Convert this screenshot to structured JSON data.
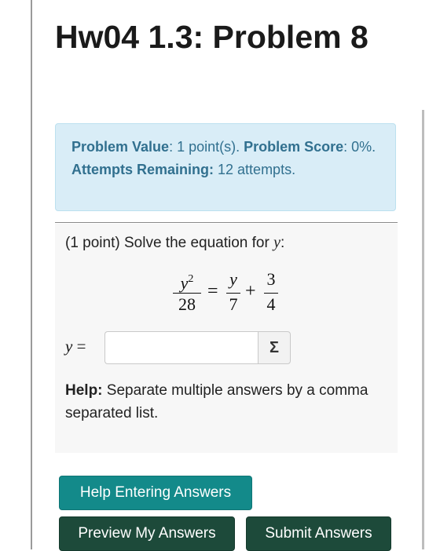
{
  "page": {
    "title": "Hw04 1.3: Problem 8"
  },
  "info": {
    "value_label": "Problem Value",
    "value_text": ": 1 point(s). ",
    "score_label": "Problem Score",
    "score_text": ": 0%. ",
    "attempts_label": "Attempts Remaining:",
    "attempts_text": " 12 attempts."
  },
  "problem": {
    "prompt_text": "(1 point) Solve the equation for ",
    "prompt_var": "y",
    "prompt_end": ":",
    "equation": {
      "lhs_num_var": "y",
      "lhs_num_exp": "2",
      "lhs_den": "28",
      "equals": "=",
      "rhs1_num": "y",
      "rhs1_den": "7",
      "plus": "+",
      "rhs2_num": "3",
      "rhs2_den": "4"
    },
    "answer_label_var": "y",
    "answer_label_eq": " =",
    "answer_value": "",
    "equation_editor_icon": "Σ",
    "help_label": "Help:",
    "help_text": " Separate multiple answers by a comma separated list."
  },
  "buttons": {
    "help_entering": "Help Entering Answers",
    "preview": "Preview My Answers",
    "submit": "Submit Answers"
  },
  "colors": {
    "info_bg": "#d9edf7",
    "info_text": "#31708f",
    "help_button": "#138a8a",
    "action_button": "#1d4a3a"
  }
}
